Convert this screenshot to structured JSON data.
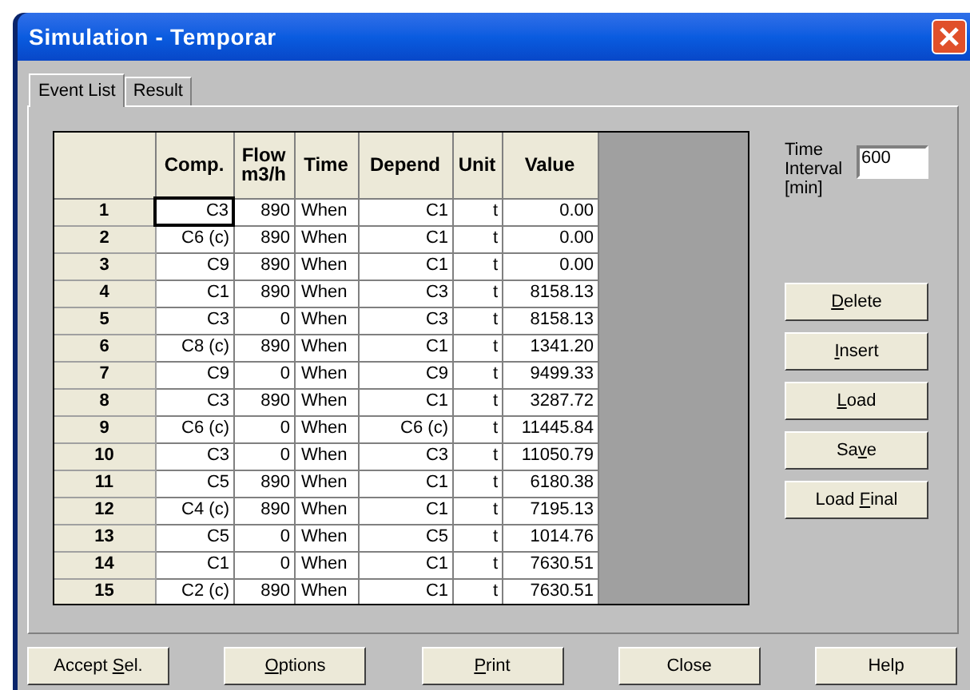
{
  "window": {
    "title": "Simulation - Temporar"
  },
  "tabs": [
    {
      "label": "Event List",
      "selected": true
    },
    {
      "label": "Result",
      "selected": false
    }
  ],
  "table": {
    "columns": [
      "Comp.",
      "Flow m3/h",
      "Time",
      "Depend",
      "Unit",
      "Value"
    ],
    "rows": [
      {
        "num": "1",
        "cells": [
          "C3",
          "890",
          "When",
          "C1",
          "t",
          "0.00"
        ],
        "focused": true
      },
      {
        "num": "2",
        "cells": [
          "C6 (c)",
          "890",
          "When",
          "C1",
          "t",
          "0.00"
        ],
        "focused": false
      },
      {
        "num": "3",
        "cells": [
          "C9",
          "890",
          "When",
          "C1",
          "t",
          "0.00"
        ],
        "focused": false
      },
      {
        "num": "4",
        "cells": [
          "C1",
          "890",
          "When",
          "C3",
          "t",
          "8158.13"
        ],
        "focused": false
      },
      {
        "num": "5",
        "cells": [
          "C3",
          "0",
          "When",
          "C3",
          "t",
          "8158.13"
        ],
        "focused": false
      },
      {
        "num": "6",
        "cells": [
          "C8 (c)",
          "890",
          "When",
          "C1",
          "t",
          "1341.20"
        ],
        "focused": false
      },
      {
        "num": "7",
        "cells": [
          "C9",
          "0",
          "When",
          "C9",
          "t",
          "9499.33"
        ],
        "focused": false
      },
      {
        "num": "8",
        "cells": [
          "C3",
          "890",
          "When",
          "C1",
          "t",
          "3287.72"
        ],
        "focused": false
      },
      {
        "num": "9",
        "cells": [
          "C6 (c)",
          "0",
          "When",
          "C6 (c)",
          "t",
          "11445.84"
        ],
        "focused": false
      },
      {
        "num": "10",
        "cells": [
          "C3",
          "0",
          "When",
          "C3",
          "t",
          "11050.79"
        ],
        "focused": false
      },
      {
        "num": "11",
        "cells": [
          "C5",
          "890",
          "When",
          "C1",
          "t",
          "6180.38"
        ],
        "focused": false
      },
      {
        "num": "12",
        "cells": [
          "C4 (c)",
          "890",
          "When",
          "C1",
          "t",
          "7195.13"
        ],
        "focused": false
      },
      {
        "num": "13",
        "cells": [
          "C5",
          "0",
          "When",
          "C5",
          "t",
          "1014.76"
        ],
        "focused": false
      },
      {
        "num": "14",
        "cells": [
          "C1",
          "0",
          "When",
          "C1",
          "t",
          "7630.51"
        ],
        "focused": false
      },
      {
        "num": "15",
        "cells": [
          "C2 (c)",
          "890",
          "When",
          "C1",
          "t",
          "7630.51"
        ],
        "focused": false
      }
    ]
  },
  "time_interval": {
    "label": "Time Interval [min]",
    "value": "600"
  },
  "side_buttons": [
    {
      "key": "D",
      "post": "elete"
    },
    {
      "key": "I",
      "post": "nsert"
    },
    {
      "key": "L",
      "post": "oad"
    },
    {
      "pre": "Sa",
      "key": "v",
      "post": "e"
    },
    {
      "pre": "Load ",
      "key": "F",
      "post": "inal"
    }
  ],
  "bottom_buttons": [
    {
      "pre": "Accept ",
      "key": "S",
      "post": "el."
    },
    {
      "key": "O",
      "post": "ptions"
    },
    {
      "key": "P",
      "post": "rint"
    },
    {
      "pre": "Close"
    },
    {
      "pre": "Help"
    }
  ]
}
